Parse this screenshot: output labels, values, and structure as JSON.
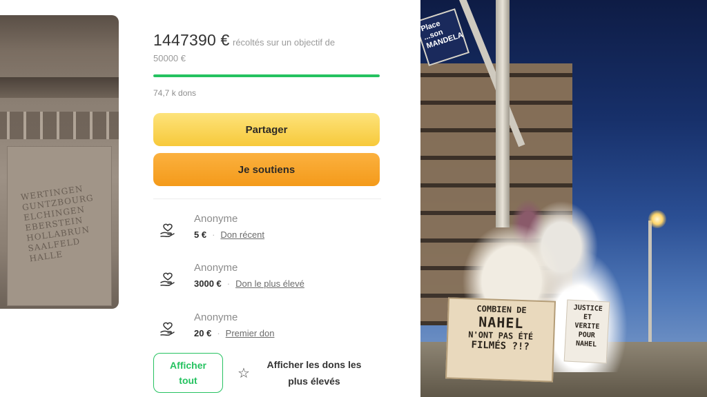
{
  "campaign": {
    "amount_raised": "1447390 €",
    "amount_desc": "récoltés sur un objectif de",
    "goal": "50000 €",
    "progress_fraction": 1.0,
    "donors_count": "74,7 k dons"
  },
  "actions": {
    "share_label": "Partager",
    "support_label": "Je soutiens"
  },
  "donations": [
    {
      "name": "Anonyme",
      "amount": "5 €",
      "tag": "Don récent"
    },
    {
      "name": "Anonyme",
      "amount": "3000 €",
      "tag": "Don le plus élevé"
    },
    {
      "name": "Anonyme",
      "amount": "20 €",
      "tag": "Premier don"
    }
  ],
  "footer_buttons": {
    "show_all_line1": "Afficher",
    "show_all_line2": "tout",
    "top_donations_line1": "Afficher les dons les",
    "top_donations_line2": "plus élevés"
  },
  "photos": {
    "monument_inscription": [
      "WERTINGEN",
      "GUNTZBOURG",
      "ELCHINGEN",
      "EBERSTEIN",
      "HOLLABRUN",
      "SAALFELD",
      "HALLE"
    ],
    "street_sign": [
      "Place",
      "...son MANDELA"
    ],
    "sign_main": [
      "COMBIEN DE",
      "NAHEL",
      "N'ONT PAS ÉTÉ",
      "FILMÉS ?!?"
    ],
    "sign_small": [
      "JUSTICE",
      "ET",
      "VERITE",
      "POUR",
      "NAHEL"
    ]
  },
  "colors": {
    "accent_green": "#25c260",
    "share_yellow": "#f7c93a",
    "support_orange": "#f49a1a"
  }
}
